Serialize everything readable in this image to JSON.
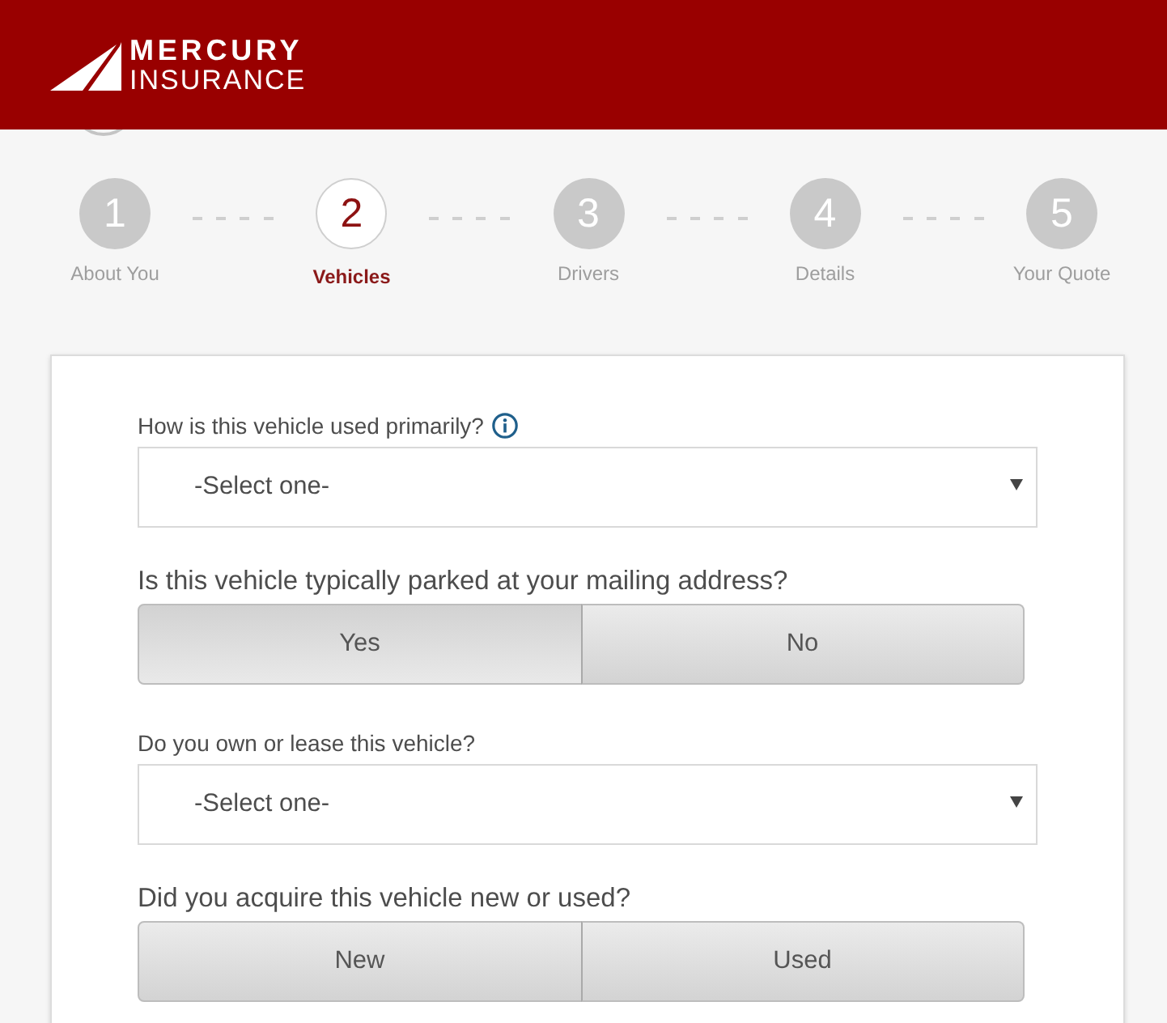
{
  "header": {
    "logo": {
      "line_1": "MERCURY",
      "line_2": "INSURANCE"
    }
  },
  "steps": [
    {
      "number": "1",
      "label": "About You",
      "selected": false
    },
    {
      "number": "2",
      "label": "Vehicles",
      "selected": true
    },
    {
      "number": "3",
      "label": "Drivers",
      "selected": false
    },
    {
      "number": "4",
      "label": "Details",
      "selected": false
    },
    {
      "number": "5",
      "label": "Your Quote",
      "selected": false
    }
  ],
  "form": {
    "fields": [
      {
        "kind": "select",
        "label": "How is this vehicle used primarily?",
        "info": true,
        "placeholder": "-Select one-"
      },
      {
        "kind": "toggle",
        "label": "Is this vehicle typically parked at your mailing address?",
        "info": false,
        "options": [
          {
            "label": "Yes",
            "selected": true
          },
          {
            "label": "No",
            "selected": false
          }
        ]
      },
      {
        "kind": "select",
        "label": "Do you own or lease this vehicle?",
        "info": false,
        "placeholder": "-Select one-"
      },
      {
        "kind": "toggle",
        "label": "Did you acquire this vehicle new or used?",
        "info": false,
        "options": [
          {
            "label": "New",
            "selected": false
          },
          {
            "label": "Used",
            "selected": false
          }
        ]
      }
    ]
  }
}
